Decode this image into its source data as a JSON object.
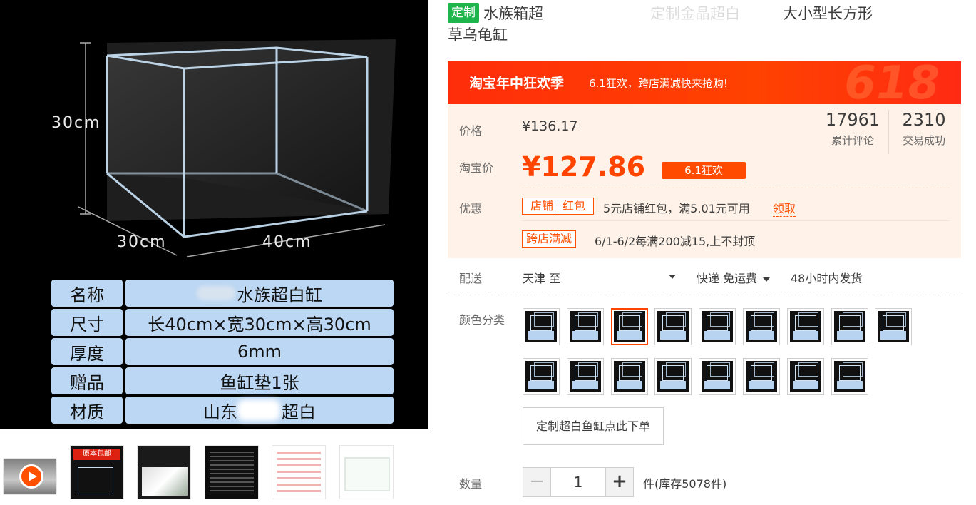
{
  "main_image": {
    "dims": {
      "height": "30cm",
      "depth": "30cm",
      "width": "40cm"
    },
    "specs": [
      {
        "key": "名称",
        "value": "水族超白缸"
      },
      {
        "key": "尺寸",
        "value": "长40cm×宽30cm×高30cm"
      },
      {
        "key": "厚度",
        "value": "6mm"
      },
      {
        "key": "赠品",
        "value": "鱼缸垫1张"
      },
      {
        "key": "材质",
        "value_prefix": "山东",
        "value_suffix": "超白"
      }
    ]
  },
  "thumbnails": [
    {
      "name": "video"
    },
    {
      "name": "thumb-2",
      "text": "原本包邮"
    },
    {
      "name": "thumb-3"
    },
    {
      "name": "thumb-4"
    },
    {
      "name": "thumb-5"
    },
    {
      "name": "thumb-6"
    }
  ],
  "product": {
    "tag": "定制",
    "title_part1": "水族箱超",
    "title_part2": "定制金晶超白",
    "title_part3": "大小型长方形",
    "title_line2": "草乌龟缸"
  },
  "banner": {
    "main": "淘宝年中狂欢季",
    "sub": "6.1狂欢，跨店满减快来抢购!",
    "deco": "618"
  },
  "price": {
    "price_label": "价格",
    "original": "¥136.17",
    "taobao_label": "淘宝价",
    "current": "¥127.86",
    "promo_tag": "6.1狂欢"
  },
  "stats": {
    "reviews": {
      "count": "17961",
      "label": "累计评论"
    },
    "deals": {
      "count": "2310",
      "label": "交易成功"
    }
  },
  "offers": {
    "label": "优惠",
    "shop_coupon": "店铺",
    "red_packet": "红包",
    "coupon_text": "5元店铺红包，满5.01元可用",
    "claim_link": "领取",
    "cross_store": "跨店满减",
    "cross_text": "6/1-6/2每满200减15,上不封顶"
  },
  "shipping": {
    "label": "配送",
    "from": "天津 至",
    "method": "快递 免运费",
    "delivery": "48小时内发货"
  },
  "sku": {
    "label": "颜色分类",
    "count": 17,
    "selected_index": 2,
    "text_option": "定制超白鱼缸点此下单"
  },
  "quantity": {
    "label": "数量",
    "value": "1",
    "minus": "−",
    "plus": "+",
    "stock": "件(库存5078件)"
  }
}
